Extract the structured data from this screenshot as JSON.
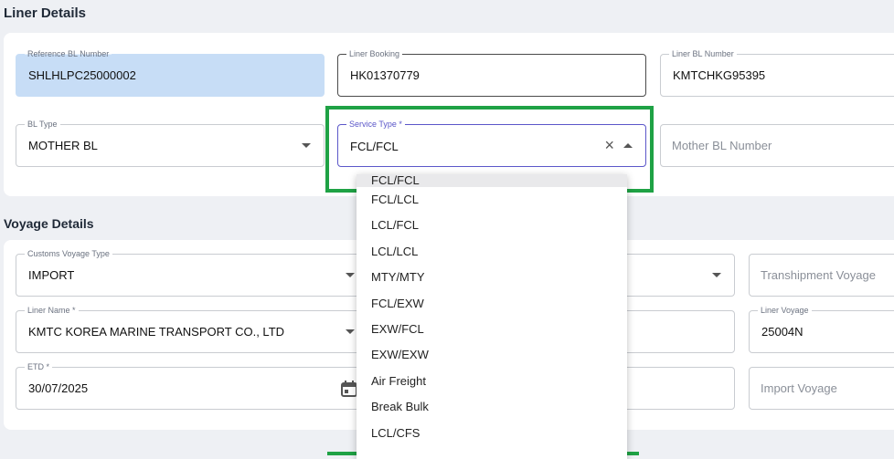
{
  "liner_details": {
    "title": "Liner Details",
    "reference_bl": {
      "label": "Reference BL Number",
      "value": "SHLHLPC25000002"
    },
    "liner_booking": {
      "label": "Liner Booking",
      "value": "HK01370779"
    },
    "liner_bl": {
      "label": "Liner BL Number",
      "value": "KMTCHKG95395"
    },
    "bl_type": {
      "label": "BL Type",
      "value": "MOTHER BL"
    },
    "service_type": {
      "label": "Service Type *",
      "value": "FCL/FCL"
    },
    "mother_bl": {
      "placeholder": "Mother BL Number"
    }
  },
  "service_type_options": [
    "FCL/FCL",
    "FCL/LCL",
    "LCL/FCL",
    "LCL/LCL",
    "MTY/MTY",
    "FCL/EXW",
    "EXW/FCL",
    "EXW/EXW",
    "Air Freight",
    "Break Bulk",
    "LCL/CFS"
  ],
  "voyage_details": {
    "title": "Voyage Details",
    "customs_voyage_type": {
      "label": "Customs Voyage Type",
      "value": "IMPORT"
    },
    "transhipment_voyage": {
      "placeholder": "Transhipment Voyage"
    },
    "liner_name": {
      "label": "Liner Name *",
      "value": "KMTC KOREA MARINE TRANSPORT CO., LTD"
    },
    "liner_voyage": {
      "label": "Liner Voyage",
      "value": "25004N"
    },
    "etd": {
      "label": "ETD *",
      "value": "30/07/2025"
    },
    "import_voyage": {
      "placeholder": "Import Voyage"
    }
  },
  "colors": {
    "highlight": "#1fa245",
    "focus": "#5b57c9",
    "filled": "#c7ddf6"
  }
}
